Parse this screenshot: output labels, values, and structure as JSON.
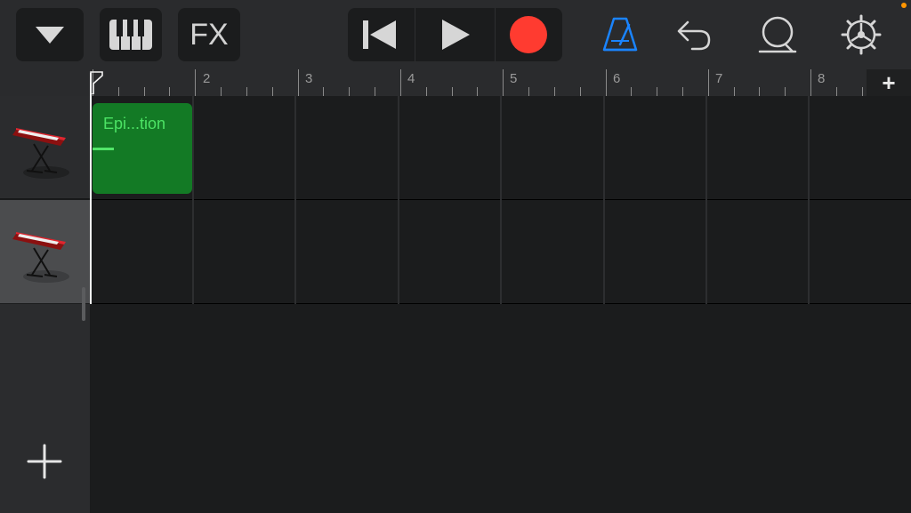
{
  "toolbar": {
    "tracks_dropdown_icon": "triangle-down-icon",
    "keyboard_icon": "piano-keys-icon",
    "fx_label": "FX",
    "rewind_icon": "skip-to-start-icon",
    "play_icon": "play-icon",
    "record_icon": "record-icon",
    "metronome_icon": "metronome-icon",
    "undo_icon": "undo-icon",
    "loop_icon": "loop-browser-icon",
    "settings_icon": "gear-icon"
  },
  "colors": {
    "accent_blue": "#1a84ff",
    "record_red": "#ff3b30",
    "region_green": "#137a25",
    "region_text": "#4ce364",
    "status_dot": "#ff9500"
  },
  "ruler": {
    "bars": [
      "2",
      "3",
      "4",
      "5",
      "6",
      "7",
      "8"
    ],
    "add_section_label": "+"
  },
  "tracks": [
    {
      "instrument_icon": "keyboard-synth-icon"
    },
    {
      "instrument_icon": "keyboard-synth-icon"
    }
  ],
  "regions": [
    {
      "name": "Epi...tion",
      "track": 1
    }
  ],
  "sidebar": {
    "add_track_label": "+"
  }
}
